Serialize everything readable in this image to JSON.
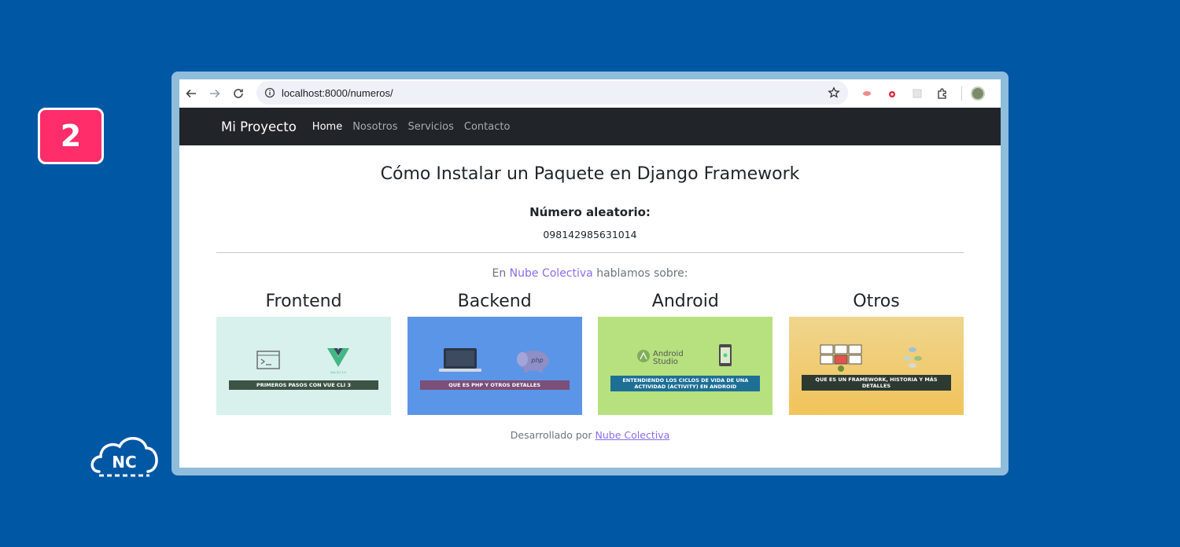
{
  "step_badge": "2",
  "logo": {
    "text": "NC",
    "name": "Nube Colectiva"
  },
  "browser": {
    "url": "localhost:8000/numeros/"
  },
  "navbar": {
    "brand": "Mi Proyecto",
    "links": [
      "Home",
      "Nosotros",
      "Servicios",
      "Contacto"
    ],
    "active": "Home"
  },
  "main": {
    "title": "Cómo Instalar un Paquete en Django Framework",
    "random_label": "Número aleatorio:",
    "random_value": "098142985631014",
    "intro_prefix": "En ",
    "intro_link": "Nube Colectiva ",
    "intro_suffix": "hablamos sobre:"
  },
  "cards": [
    {
      "title": "Frontend",
      "banner": "PRIMEROS PASOS CON VUE CLI 3",
      "bg": "#d8f1ec",
      "banner_color": "#3d5346"
    },
    {
      "title": "Backend",
      "banner": "QUE ES PHP Y OTROS DETALLES",
      "bg": "#5b95e8",
      "banner_color": "#7b4f78"
    },
    {
      "title": "Android",
      "banner": "ENTENDIENDO LOS CICLOS DE VIDA DE UNA ACTIVIDAD (ACTIVITY) EN ANDROID",
      "bg": "#b7e07f",
      "banner_color": "#1d6f96"
    },
    {
      "title": "Otros",
      "banner": "QUE ES UN FRAMEWORK, HISTORIA Y MÁS DETALLES",
      "bg": "#f0cf82",
      "banner_color": "#2d3a32"
    }
  ],
  "card_art": {
    "vue_caption": "Vue CLI 3.0",
    "php_label": "php",
    "android_studio": [
      "Android",
      "Studio"
    ]
  },
  "footer": {
    "prefix": "Desarrollado por ",
    "link": "Nube Colectiva"
  }
}
